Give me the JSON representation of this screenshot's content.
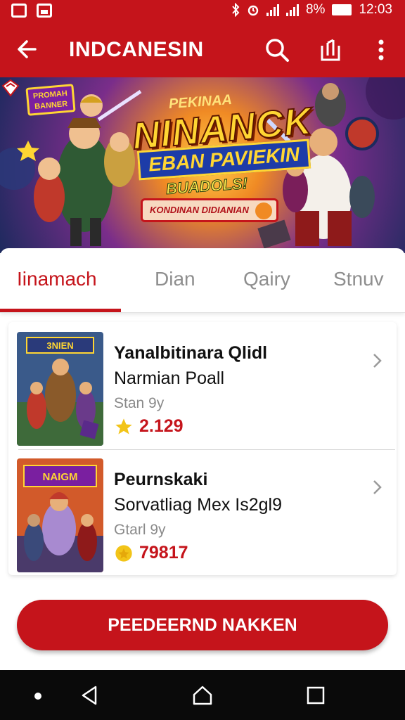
{
  "status_bar": {
    "battery": "8%",
    "time": "12:03"
  },
  "app_bar": {
    "title": "INDCANESIN",
    "icons": [
      "back-arrow-icon",
      "search-icon",
      "share-icon",
      "more-vert-icon"
    ]
  },
  "banner": {
    "badge": "PROMAH BANNER",
    "kicker": "PEKINAA",
    "headline": "NINANCK",
    "subheadline": "EBAN PAVIEKIN",
    "tagline": "BUADOLS!",
    "pill_text": "KONDINAN DIDIANIAN"
  },
  "tabs": [
    {
      "label": "Iinamach",
      "active": true
    },
    {
      "label": "Dian",
      "active": false
    },
    {
      "label": "Qairy",
      "active": false
    },
    {
      "label": "Stnuv",
      "active": false
    }
  ],
  "items": [
    {
      "title": "Yanalbitinara Qlidl",
      "subtitle": "Narmian Poall",
      "meta": "Stan 9y",
      "rating": "2.129",
      "thumb_caption": "3NIEN"
    },
    {
      "title": "Peurnskaki",
      "subtitle": "Sorvatliag Mex Is2gl9",
      "meta": "Gtarl 9y",
      "rating": "79817",
      "thumb_caption": "NAIGM"
    }
  ],
  "cta": {
    "label": "PEEDEERND NAKKEN"
  },
  "colors": {
    "primary": "#c5141b",
    "navbar": "#0a0a0a",
    "rating": "#c5141b",
    "star": "#f2c418"
  }
}
